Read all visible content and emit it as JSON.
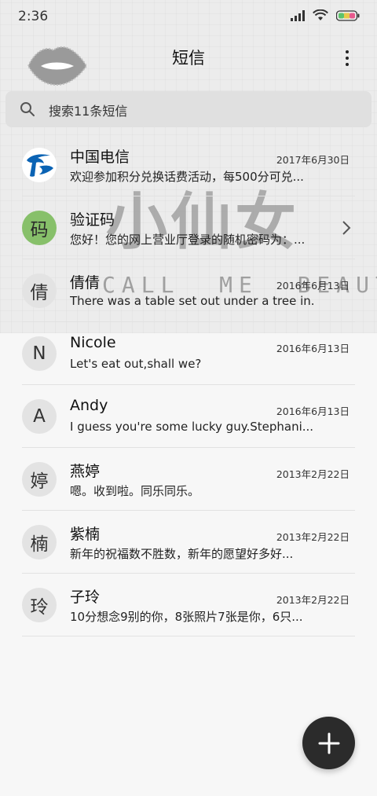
{
  "status_bar": {
    "time": "2:36",
    "icons": [
      "signal-icon",
      "wifi-icon",
      "battery-icon"
    ]
  },
  "header": {
    "title": "短信",
    "menu_icon": "more-vert-icon"
  },
  "search": {
    "placeholder": "搜索11条短信",
    "icon": "search-icon"
  },
  "theme": {
    "watermark_title": "小仙女",
    "watermark_sub": "CALL  ME  BEAUTY"
  },
  "conversations": [
    {
      "avatar": "",
      "avatar_icon": "china-telecom-logo-icon",
      "name": "中国电信",
      "date": "2017年6月30日",
      "preview": "欢迎参加积分兑换话费活动，每500分可兑..."
    },
    {
      "avatar": "码",
      "name": "验证码",
      "date": "",
      "preview": "您好！您的网上营业厅登录的随机密码为：...",
      "has_chevron": true
    },
    {
      "avatar": "倩",
      "name": "倩倩",
      "date": "2016年6月13日",
      "preview": "There was a table set out under a tree in..."
    },
    {
      "avatar": "N",
      "name": "Nicole",
      "date": "2016年6月13日",
      "preview": "Let's eat out,shall we?"
    },
    {
      "avatar": "A",
      "name": "Andy",
      "date": "2016年6月13日",
      "preview": "I guess you're some lucky guy.Stephani..."
    },
    {
      "avatar": "婷",
      "name": "燕婷",
      "date": "2013年2月22日",
      "preview": "嗯。收到啦。同乐同乐。"
    },
    {
      "avatar": "楠",
      "name": "紫楠",
      "date": "2013年2月22日",
      "preview": "新年的祝福数不胜数，新年的愿望好多好..."
    },
    {
      "avatar": "玲",
      "name": "子玲",
      "date": "2013年2月22日",
      "preview": "10分想念9别的你，8张照片7张是你，6只..."
    }
  ],
  "fab": {
    "icon": "plus-icon"
  },
  "colors": {
    "accent_green": "#87c06a",
    "telecom_blue": "#0a63b4",
    "fab": "#2b2b2b"
  }
}
